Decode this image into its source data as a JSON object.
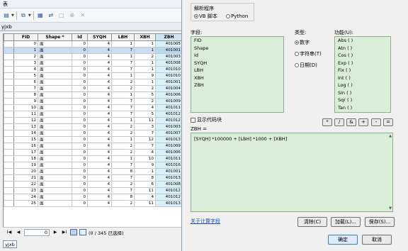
{
  "table_window": {
    "title": "表",
    "table_name": "yjxb",
    "columns": [
      "",
      "FID",
      "Shape *",
      "Id",
      "SYQH",
      "LBH",
      "XBH",
      "ZBH"
    ],
    "rows": [
      [
        "0",
        "面",
        "0",
        "4",
        "1",
        "1",
        "401005"
      ],
      [
        "1",
        "面",
        "0",
        "4",
        "7",
        "1",
        "401001"
      ],
      [
        "2",
        "面",
        "0",
        "4",
        "1",
        "2",
        "401003"
      ],
      [
        "3",
        "面",
        "0",
        "4",
        "7",
        "1",
        "401008"
      ],
      [
        "4",
        "面",
        "0",
        "4",
        "7",
        "1",
        "401010"
      ],
      [
        "5",
        "面",
        "0",
        "4",
        "1",
        "9",
        "401010"
      ],
      [
        "6",
        "面",
        "0",
        "4",
        "2",
        "1",
        "401001"
      ],
      [
        "7",
        "面",
        "0",
        "4",
        "2",
        "2",
        "401004"
      ],
      [
        "8",
        "面",
        "0",
        "4",
        "1",
        "5",
        "401006"
      ],
      [
        "9",
        "面",
        "0",
        "4",
        "7",
        "2",
        "401009"
      ],
      [
        "10",
        "面",
        "0",
        "4",
        "7",
        "4",
        "401011"
      ],
      [
        "11",
        "面",
        "0",
        "4",
        "7",
        "5",
        "401012"
      ],
      [
        "12",
        "面",
        "0",
        "4",
        "1",
        "11",
        "401012"
      ],
      [
        "13",
        "面",
        "0",
        "4",
        "2",
        "3",
        "401003"
      ],
      [
        "14",
        "面",
        "0",
        "4",
        "2",
        "7",
        "401007"
      ],
      [
        "15",
        "面",
        "0",
        "4",
        "1",
        "12",
        "401013"
      ],
      [
        "16",
        "面",
        "0",
        "4",
        "2",
        "7",
        "401009"
      ],
      [
        "17",
        "面",
        "0",
        "4",
        "2",
        "4",
        "401006"
      ],
      [
        "18",
        "面",
        "0",
        "4",
        "1",
        "10",
        "401011"
      ],
      [
        "19",
        "面",
        "0",
        "4",
        "7",
        "9",
        "401016"
      ],
      [
        "20",
        "面",
        "0",
        "4",
        "8",
        "1",
        "401001"
      ],
      [
        "21",
        "面",
        "0",
        "4",
        "7",
        "8",
        "401013"
      ],
      [
        "22",
        "面",
        "0",
        "4",
        "2",
        "6",
        "401008"
      ],
      [
        "23",
        "面",
        "0",
        "4",
        "7",
        "11",
        "401012"
      ],
      [
        "24",
        "面",
        "0",
        "4",
        "8",
        "4",
        "401012"
      ],
      [
        "25",
        "面",
        "0",
        "4",
        "2",
        "11",
        "401013"
      ]
    ],
    "nav": {
      "record_index": "0",
      "status": "(0 / 345 已选择)",
      "first": "I◀",
      "prev": "◀",
      "next": "▶",
      "last": "▶I"
    },
    "bottom_tab": "yjxb"
  },
  "dialog": {
    "parser_label": "解析程序",
    "parser_vb": "VB 脚本",
    "parser_python": "Python",
    "fields_label": "字段:",
    "fields": [
      "FID",
      "Shape",
      "Id",
      "SYQH",
      "LBH",
      "XBH",
      "ZBH"
    ],
    "type_label": "类型:",
    "types": [
      "数字",
      "字符串(T)",
      "日期(D)"
    ],
    "functions_label": "功能(U):",
    "functions": [
      "Abs ( )",
      "Atn ( )",
      "Cos ( )",
      "Exp ( )",
      "Fix ( )",
      "Int ( )",
      "Log ( )",
      "Sin ( )",
      "Sqr ( )",
      "Tan ( )"
    ],
    "show_codeblock": "显示代码块",
    "expression_label": "ZBH =",
    "expression": "[SYQH] *100000 + [LBH] *1000 + [XBH]",
    "operators": [
      "*",
      "/",
      "&",
      "+",
      "-",
      "="
    ],
    "help_link": "关于计算字段",
    "clear_button": "清除(C)",
    "load_button": "加载(L)...",
    "save_button": "保存(S)...",
    "ok_button": "确定",
    "cancel_button": "取消"
  }
}
